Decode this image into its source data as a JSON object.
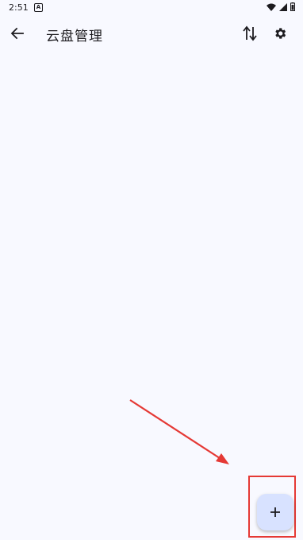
{
  "status_bar": {
    "time": "2:51",
    "notification_icon": "A"
  },
  "app_bar": {
    "title": "云盘管理",
    "back_icon": "arrow-left-icon",
    "sort_icon": "sort-arrows-icon",
    "settings_icon": "gear-icon"
  },
  "fab": {
    "icon": "plus-icon"
  },
  "colors": {
    "background": "#f8f9ff",
    "fab_background": "#d8e2ff",
    "annotation": "#e53935",
    "text": "#1c1b1f"
  }
}
